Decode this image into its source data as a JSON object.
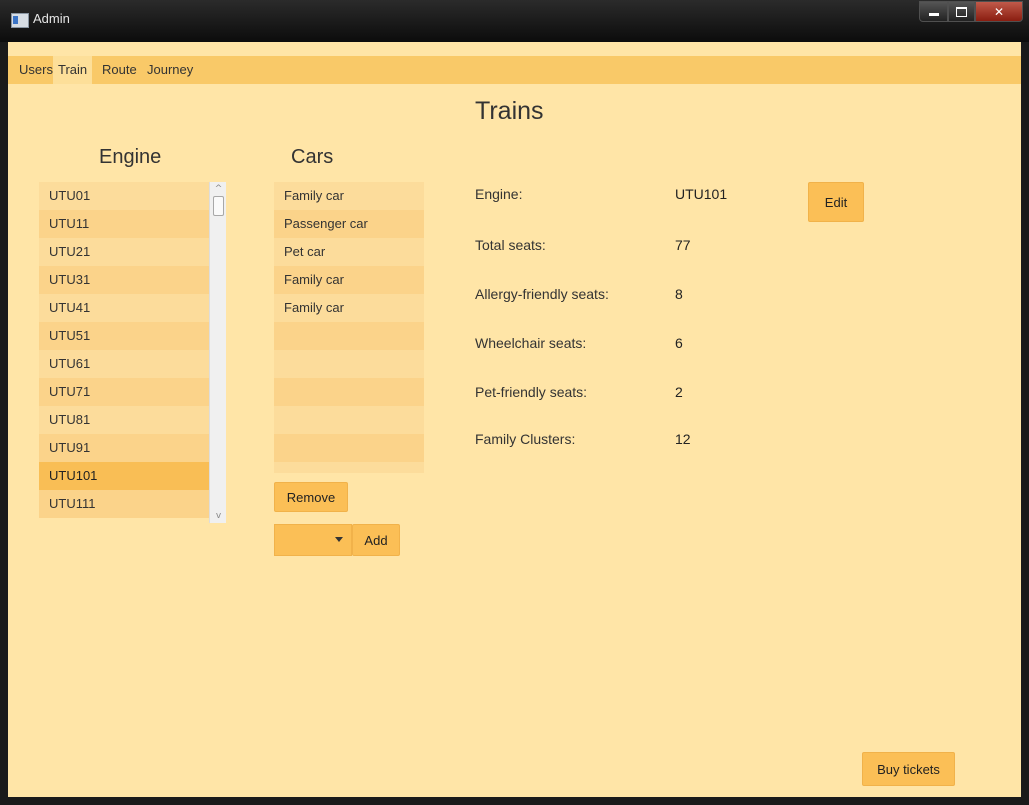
{
  "window": {
    "title": "Admin"
  },
  "tabs": [
    {
      "label": "Users"
    },
    {
      "label": "Train"
    },
    {
      "label": "Route"
    },
    {
      "label": "Journey"
    }
  ],
  "page_title": "Trains",
  "engine": {
    "heading": "Engine",
    "items": [
      "UTU01",
      "UTU11",
      "UTU21",
      "UTU31",
      "UTU41",
      "UTU51",
      "UTU61",
      "UTU71",
      "UTU81",
      "UTU91",
      "UTU101",
      "UTU111"
    ],
    "selected": "UTU101"
  },
  "cars": {
    "heading": "Cars",
    "items": [
      "Family car",
      "Passenger car",
      "Pet car",
      "Family car",
      "Family car",
      "",
      "",
      "",
      "",
      "",
      ""
    ],
    "remove_label": "Remove",
    "add_label": "Add"
  },
  "details": {
    "engine_label": "Engine:",
    "engine_value": "UTU101",
    "edit_label": "Edit",
    "total_seats_label": "Total seats:",
    "total_seats_value": "77",
    "allergy_label": "Allergy-friendly seats:",
    "allergy_value": "8",
    "wheelchair_label": "Wheelchair seats:",
    "wheelchair_value": "6",
    "pet_label": "Pet-friendly seats:",
    "pet_value": "2",
    "family_label": "Family Clusters:",
    "family_value": "12"
  },
  "buy_tickets_label": "Buy tickets",
  "colors": {
    "background": "#ffe5a7",
    "accent": "#fbbf56",
    "tabbar": "#f9c968"
  },
  "icons": {
    "app": "app-icon",
    "minimize": "minimize-icon",
    "maximize": "maximize-icon",
    "close": "close-icon",
    "dropdown": "chevron-down-icon"
  }
}
